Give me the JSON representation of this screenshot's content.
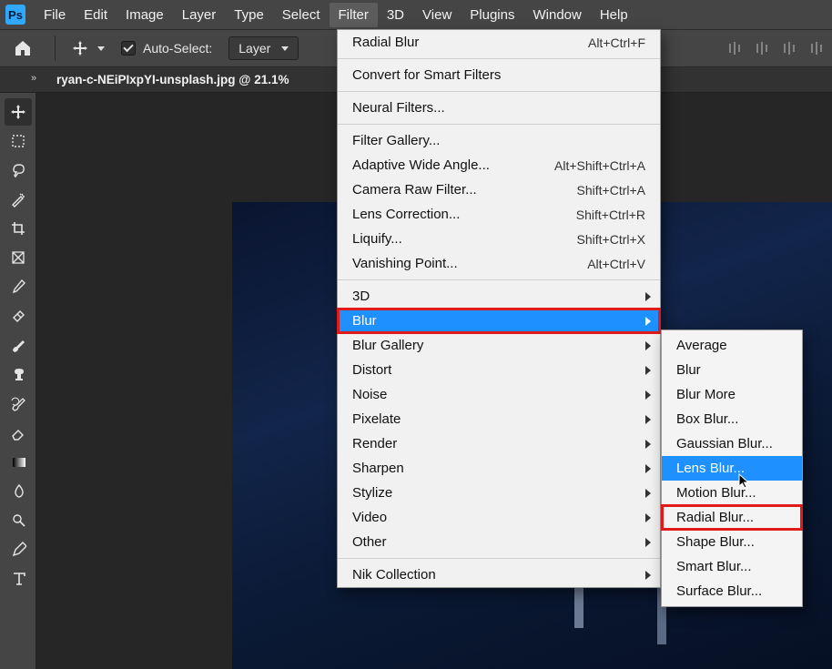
{
  "app_logo": "Ps",
  "menubar": [
    "File",
    "Edit",
    "Image",
    "Layer",
    "Type",
    "Select",
    "Filter",
    "3D",
    "View",
    "Plugins",
    "Window",
    "Help"
  ],
  "menubar_active": "Filter",
  "options": {
    "auto_select_label": "Auto-Select:",
    "layer_dropdown": "Layer"
  },
  "document_tab": "ryan-c-NEiPIxpYI-unsplash.jpg @ 21.1%",
  "filter_menu": {
    "groups": [
      [
        {
          "label": "Radial Blur",
          "shortcut": "Alt+Ctrl+F"
        }
      ],
      [
        {
          "label": "Convert for Smart Filters"
        }
      ],
      [
        {
          "label": "Neural Filters..."
        }
      ],
      [
        {
          "label": "Filter Gallery..."
        },
        {
          "label": "Adaptive Wide Angle...",
          "shortcut": "Alt+Shift+Ctrl+A"
        },
        {
          "label": "Camera Raw Filter...",
          "shortcut": "Shift+Ctrl+A"
        },
        {
          "label": "Lens Correction...",
          "shortcut": "Shift+Ctrl+R"
        },
        {
          "label": "Liquify...",
          "shortcut": "Shift+Ctrl+X"
        },
        {
          "label": "Vanishing Point...",
          "shortcut": "Alt+Ctrl+V"
        }
      ],
      [
        {
          "label": "3D",
          "submenu": true
        },
        {
          "label": "Blur",
          "submenu": true,
          "hovered": true,
          "redbox": true
        },
        {
          "label": "Blur Gallery",
          "submenu": true
        },
        {
          "label": "Distort",
          "submenu": true
        },
        {
          "label": "Noise",
          "submenu": true
        },
        {
          "label": "Pixelate",
          "submenu": true
        },
        {
          "label": "Render",
          "submenu": true
        },
        {
          "label": "Sharpen",
          "submenu": true
        },
        {
          "label": "Stylize",
          "submenu": true
        },
        {
          "label": "Video",
          "submenu": true
        },
        {
          "label": "Other",
          "submenu": true
        }
      ],
      [
        {
          "label": "Nik Collection",
          "submenu": true
        }
      ]
    ]
  },
  "blur_submenu": [
    {
      "label": "Average"
    },
    {
      "label": "Blur"
    },
    {
      "label": "Blur More"
    },
    {
      "label": "Box Blur..."
    },
    {
      "label": "Gaussian Blur..."
    },
    {
      "label": "Lens Blur...",
      "hovered": true
    },
    {
      "label": "Motion Blur..."
    },
    {
      "label": "Radial Blur...",
      "redbox": true
    },
    {
      "label": "Shape Blur..."
    },
    {
      "label": "Smart Blur..."
    },
    {
      "label": "Surface Blur..."
    }
  ],
  "tools": [
    "move",
    "marquee",
    "lasso",
    "wand",
    "crop",
    "frame",
    "eyedropper",
    "healing",
    "brush",
    "stamp",
    "history-brush",
    "eraser",
    "gradient",
    "blur",
    "dodge",
    "pen",
    "type"
  ]
}
